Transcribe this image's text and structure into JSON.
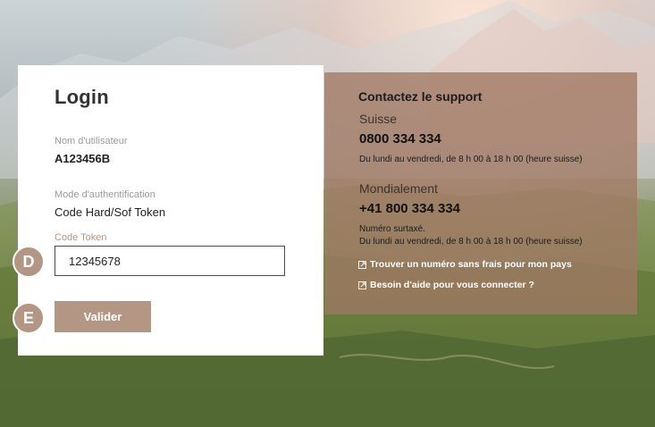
{
  "login": {
    "title": "Login",
    "username_label": "Nom d'utilisateur",
    "username_value": "A123456B",
    "auth_mode_label": "Mode d'authentification",
    "auth_mode_value": "Code Hard/Sof Token",
    "token_label": "Code Token",
    "token_value": "12345678",
    "submit_label": "Valider"
  },
  "markers": {
    "d": "D",
    "e": "E"
  },
  "support": {
    "title": "Contactez le support",
    "swiss": {
      "title": "Suisse",
      "phone": "0800 334 334",
      "hours": "Du lundi au vendredi, de 8 h 00 à 18 h 00 (heure suisse)"
    },
    "world": {
      "title": "Mondialement",
      "phone": "+41 800 334 334",
      "note": "Numéro surtaxé.",
      "hours": "Du lundi au vendredi, de 8 h 00 à 18 h 00 (heure suisse)"
    },
    "links": [
      {
        "label": "Trouver un numéro sans frais pour mon pays",
        "icon": "external-link-icon"
      },
      {
        "label": "Besoin d'aide pour vous connecter ?",
        "icon": "external-link-icon"
      }
    ]
  },
  "colors": {
    "accent": "#b39684",
    "panel": "#a07864",
    "text": "#333333"
  }
}
